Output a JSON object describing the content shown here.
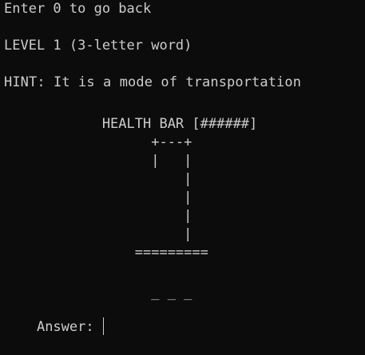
{
  "terminal": {
    "back_prompt": "Enter 0 to go back",
    "level": "LEVEL 1 (3-letter word)",
    "hint": "HINT: It is a mode of transportation",
    "health_bar": "            HEALTH BAR [######]",
    "gallows": [
      "                  +---+",
      "                  |   |",
      "                      |",
      "                      |",
      "                      |",
      "                      |",
      "                ========="
    ],
    "blanks": "                  _ _ _",
    "answer_label": "Answer: ",
    "answer_value": ""
  }
}
